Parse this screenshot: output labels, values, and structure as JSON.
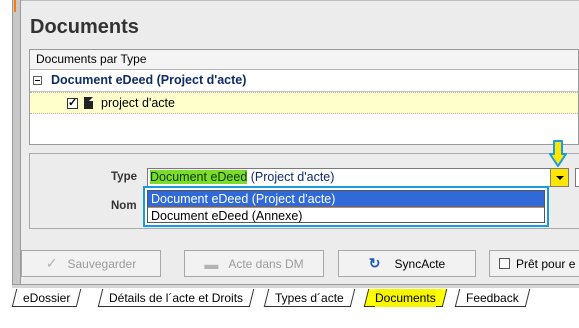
{
  "page": {
    "title": "Documents"
  },
  "tree": {
    "header": "Documents par Type",
    "group": {
      "label": "Document eDeed (Project d'acte)",
      "expanded": true
    },
    "item": {
      "label": "project d'acte",
      "checked": true
    }
  },
  "form": {
    "type_label": "Type",
    "nom_label": "Nom",
    "type_select": {
      "value_highlight": "Document eDeed",
      "value_rest": " (Project d'acte)",
      "options": [
        "Document eDeed (Project d'acte)",
        "Document eDeed (Annexe)"
      ],
      "selected_index": 0
    }
  },
  "buttons": {
    "save": "Sauvegarder",
    "acte_dm": "Acte dans DM",
    "sync": "SyncActe",
    "ready": "Prêt pour e"
  },
  "tabs": [
    {
      "label": "eDossier",
      "active": false
    },
    {
      "label": "Détails de l´acte et Droits",
      "active": false
    },
    {
      "label": "Types d´acte",
      "active": false
    },
    {
      "label": "Documents",
      "active": true
    },
    {
      "label": "Feedback",
      "active": false
    }
  ],
  "icons": {
    "save": "checkmark-icon",
    "acte_dm": "folder-icon",
    "sync": "sync-icon",
    "dropdown": "chevron-down-icon",
    "annotation": "arrow-down-icon"
  },
  "colors": {
    "highlight_green": "#7ddc2a",
    "dropdown_border": "#1a9be0",
    "selected_option": "#2f6ad8",
    "active_tab": "#ffff00",
    "item_row": "#ffffcc"
  }
}
